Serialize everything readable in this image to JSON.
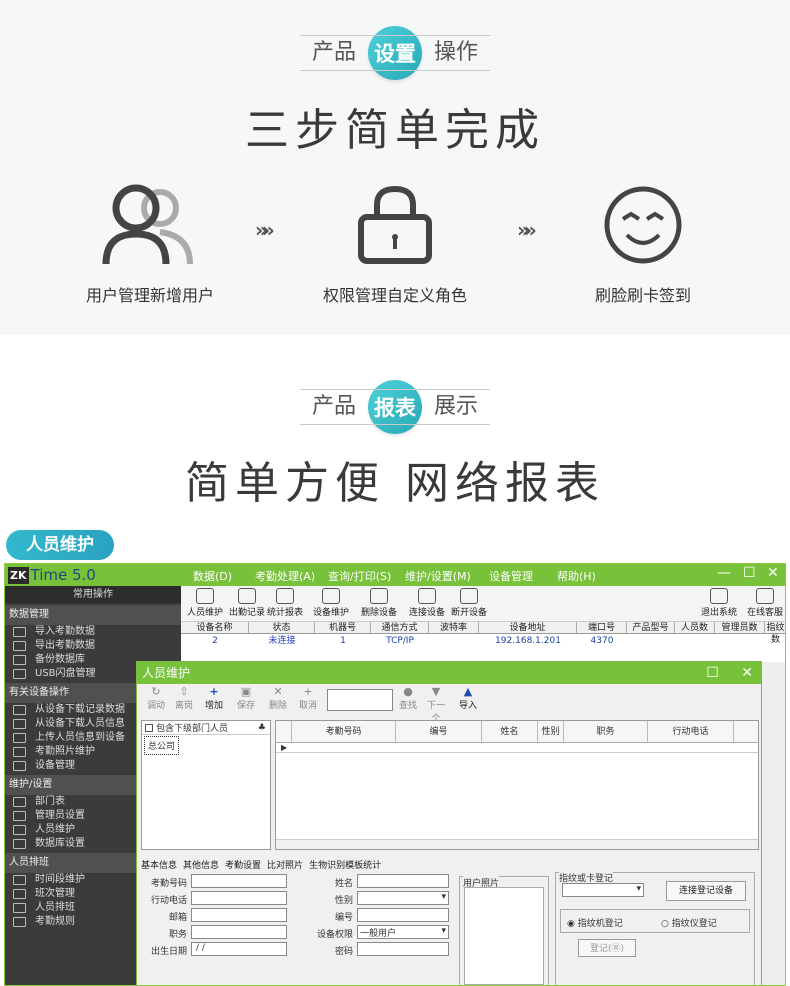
{
  "section1": {
    "pill_left": "产品",
    "pill_center": "设置",
    "pill_right": "操作",
    "title": "三步简单完成",
    "steps": [
      {
        "label": "用户管理新增用户",
        "icon": "users-icon"
      },
      {
        "label": "权限管理自定义角色",
        "icon": "lock-icon"
      },
      {
        "label": "刷脸刷卡签到",
        "icon": "smile-face-icon"
      }
    ],
    "arrow": "»»"
  },
  "section2": {
    "pill_left": "产品",
    "pill_center": "报表",
    "pill_right": "展示",
    "title": "简单方便 网络报表"
  },
  "tag": "人员维护",
  "app": {
    "logo_zk": "ZK",
    "logo_time": "Time 5.0",
    "menu": [
      "数据(D)",
      "考勤处理(A)",
      "查询/打印(S)",
      "维护/设置(M)",
      "设备管理",
      "帮助(H)"
    ],
    "win_controls": [
      "—",
      "☐",
      "✕"
    ],
    "nav": {
      "header": "常用操作",
      "groups": [
        {
          "title": "数据管理",
          "items": [
            "导入考勤数据",
            "导出考勤数据",
            "备份数据库",
            "USB闪盘管理"
          ]
        },
        {
          "title": "有关设备操作",
          "items": [
            "从设备下载记录数据",
            "从设备下载人员信息",
            "上传人员信息到设备",
            "考勤照片维护",
            "设备管理"
          ]
        },
        {
          "title": "维护/设置",
          "items": [
            "部门表",
            "管理员设置",
            "人员维护",
            "数据库设置"
          ]
        },
        {
          "title": "人员排班",
          "items": [
            "时间段维护",
            "班次管理",
            "人员排班",
            "考勤规则"
          ]
        }
      ]
    },
    "toolbar": [
      "人员维护",
      "出勤记录",
      "统计报表",
      "设备维护",
      "删除设备",
      "连接设备",
      "断开设备"
    ],
    "toolbar_right": [
      "退出系统",
      "在线客服"
    ],
    "grid_headers": [
      "设备名称",
      "状态",
      "机器号",
      "通信方式",
      "波特率",
      "设备地址",
      "端口号",
      "产品型号",
      "人员数",
      "管理员数",
      "指纹数"
    ],
    "grid_row": [
      "2",
      "未连接",
      "1",
      "TCP/IP",
      "",
      "192.168.1.201",
      "4370",
      "",
      "",
      "",
      ""
    ]
  },
  "dialog": {
    "title": "人员维护",
    "controls": [
      "☐",
      "✕"
    ],
    "toolbar": [
      {
        "icon": "↻",
        "label": "调动",
        "on": false
      },
      {
        "icon": "⇧",
        "label": "离岗",
        "on": false
      },
      {
        "icon": "+",
        "label": "增加",
        "on": true
      },
      {
        "icon": "▣",
        "label": "保存",
        "on": false
      },
      {
        "icon": "✕",
        "label": "删除",
        "on": false
      },
      {
        "icon": "+",
        "label": "取消",
        "on": false
      }
    ],
    "toolbar2": [
      {
        "icon": "●",
        "label": "查找",
        "on": false
      },
      {
        "icon": "▼",
        "label": "下一个",
        "on": false
      },
      {
        "icon": "▲",
        "label": "导入",
        "on": true
      }
    ],
    "tree_check": "包含下级部门人员",
    "tree_root": "总公司",
    "grid_headers": [
      "",
      "考勤号码",
      "编号",
      "姓名",
      "性别",
      "职务",
      "行动电话"
    ],
    "tabs": [
      "基本信息",
      "其他信息",
      "考勤设置",
      "比对照片",
      "生物识别模板统计"
    ],
    "form_left": [
      "考勤号码",
      "行动电话",
      "邮箱",
      "职务",
      "出生日期"
    ],
    "form_mid": [
      "姓名",
      "性别",
      "编号",
      "设备权限",
      "密码"
    ],
    "birth_value": "  /  /",
    "privilege_value": "一般用户",
    "photo_label": "用户照片",
    "fp_group": "指纹或卡登记",
    "connect_btn": "连接登记设备",
    "radio1": "指纹机登记",
    "radio2": "指纹仪登记",
    "register_btn": "登记(Ⓡ)"
  }
}
